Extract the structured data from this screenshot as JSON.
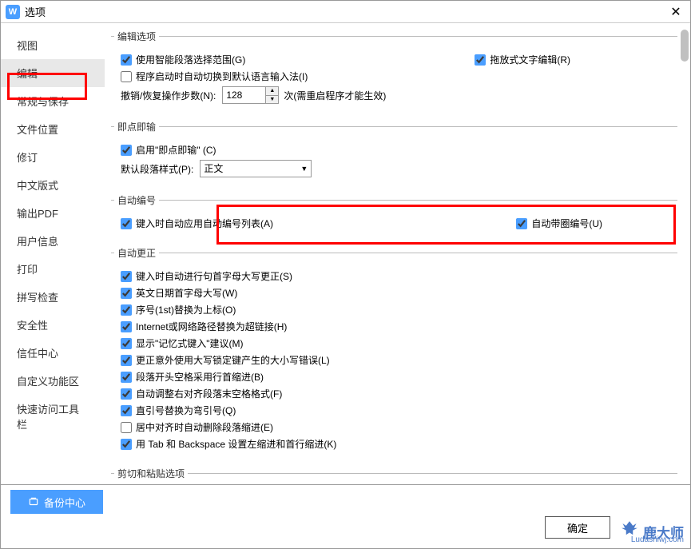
{
  "titlebar": {
    "title": "选项",
    "icon_letter": "W"
  },
  "sidebar": {
    "items": [
      {
        "label": "视图"
      },
      {
        "label": "编辑"
      },
      {
        "label": "常规与保存"
      },
      {
        "label": "文件位置"
      },
      {
        "label": "修订"
      },
      {
        "label": "中文版式"
      },
      {
        "label": "输出PDF"
      },
      {
        "label": "用户信息"
      },
      {
        "label": "打印"
      },
      {
        "label": "拼写检查"
      },
      {
        "label": "安全性"
      },
      {
        "label": "信任中心"
      },
      {
        "label": "自定义功能区"
      },
      {
        "label": "快速访问工具栏"
      }
    ],
    "active_index": 1
  },
  "sections": {
    "edit_options": {
      "legend": "编辑选项",
      "smart_para": "使用智能段落选择范围(G)",
      "drag_text": "拖放式文字编辑(R)",
      "auto_ime": "程序启动时自动切换到默认语言输入法(I)",
      "undo_label": "撤销/恢复操作步数(N):",
      "undo_value": "128",
      "undo_suffix": "次(需重启程序才能生效)"
    },
    "click_type": {
      "legend": "即点即输",
      "enable": "启用\"即点即输\" (C)",
      "default_style_label": "默认段落样式(P):",
      "default_style_value": "正文"
    },
    "auto_number": {
      "legend": "自动编号",
      "apply_list": "键入时自动应用自动编号列表(A)",
      "circle_num": "自动带圈编号(U)"
    },
    "auto_correct": {
      "legend": "自动更正",
      "items": [
        {
          "label": "键入时自动进行句首字母大写更正(S)",
          "checked": true
        },
        {
          "label": "英文日期首字母大写(W)",
          "checked": true
        },
        {
          "label": "序号(1st)替换为上标(O)",
          "checked": true
        },
        {
          "label": "Internet或网络路径替换为超链接(H)",
          "checked": true
        },
        {
          "label": "显示\"记忆式键入\"建议(M)",
          "checked": true
        },
        {
          "label": "更正意外使用大写锁定键产生的大小写错误(L)",
          "checked": true
        },
        {
          "label": "段落开头空格采用行首缩进(B)",
          "checked": true
        },
        {
          "label": "自动调整右对齐段落末空格格式(F)",
          "checked": true
        },
        {
          "label": "直引号替换为弯引号(Q)",
          "checked": true
        },
        {
          "label": "居中对齐时自动删除段落缩进(E)",
          "checked": false
        },
        {
          "label": "用 Tab 和 Backspace 设置左缩进和首行缩进(K)",
          "checked": true
        }
      ]
    },
    "cut_paste": {
      "legend": "剪切和粘贴选项"
    }
  },
  "footer": {
    "backup": "备份中心",
    "ok": "确定"
  },
  "watermark": {
    "text": "鹿大师",
    "url": "Ludashiwj.com"
  }
}
